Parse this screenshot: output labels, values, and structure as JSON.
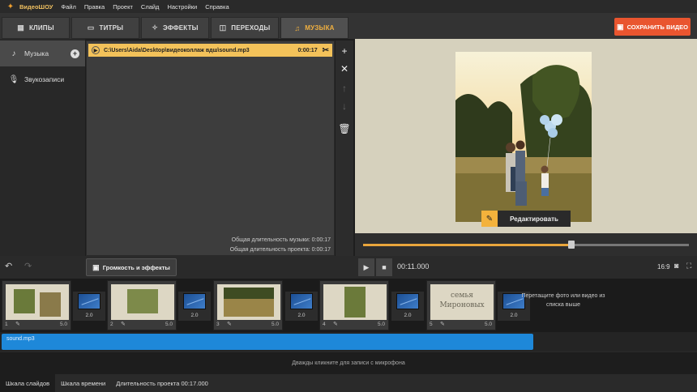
{
  "app": {
    "title": "ВидеоШОУ"
  },
  "menu": [
    "Файл",
    "Правка",
    "Проект",
    "Слайд",
    "Настройки",
    "Справка"
  ],
  "tabs": [
    {
      "label": "КЛИПЫ",
      "icon": "clips-icon"
    },
    {
      "label": "ТИТРЫ",
      "icon": "titles-icon"
    },
    {
      "label": "ЭФФЕКТЫ",
      "icon": "effects-icon"
    },
    {
      "label": "ПЕРЕХОДЫ",
      "icon": "transitions-icon"
    },
    {
      "label": "МУЗЫКА",
      "icon": "music-icon",
      "active": true
    }
  ],
  "save_button": "СОХРАНИТЬ ВИДЕО",
  "sidebar": {
    "items": [
      {
        "label": "Музыка",
        "icon": "music-note-icon",
        "active": true
      },
      {
        "label": "Звукозаписи",
        "icon": "microphone-icon"
      }
    ]
  },
  "music": {
    "track": {
      "path": "C:\\Users\\Aida\\Desktop\\видеоколлаж вдш\\sound.mp3",
      "duration": "0:00:17"
    },
    "total_music": "Общая длительность музыки: 0:00:17",
    "total_project": "Общая длительность проекта: 0:00:17"
  },
  "preview": {
    "edit_label": "Редактировать",
    "progress": 0.64
  },
  "controls": {
    "volume_label": "Громкость и эффекты",
    "timecode": "00:11.000",
    "ratio": "16:9"
  },
  "slides": [
    {
      "num": "1",
      "dur": "5.0"
    },
    {
      "num": "2",
      "dur": "5.0"
    },
    {
      "num": "3",
      "dur": "5.0"
    },
    {
      "num": "4",
      "dur": "5.0"
    },
    {
      "num": "5",
      "dur": "5.0",
      "thumb_text": "семья Мироновых"
    }
  ],
  "transitions": [
    "2.0",
    "2.0",
    "2.0",
    "2.0",
    "2.0"
  ],
  "drop_hint": "Перетащите фото или видео из списка выше",
  "audio_clip": "sound.mp3",
  "mic_hint": "Дважды кликните для записи с микрофона",
  "bottom": {
    "tab_slides": "Шкала слайдов",
    "tab_timeline": "Шкала времени",
    "project_duration": "Длительность проекта 00:17.000"
  }
}
